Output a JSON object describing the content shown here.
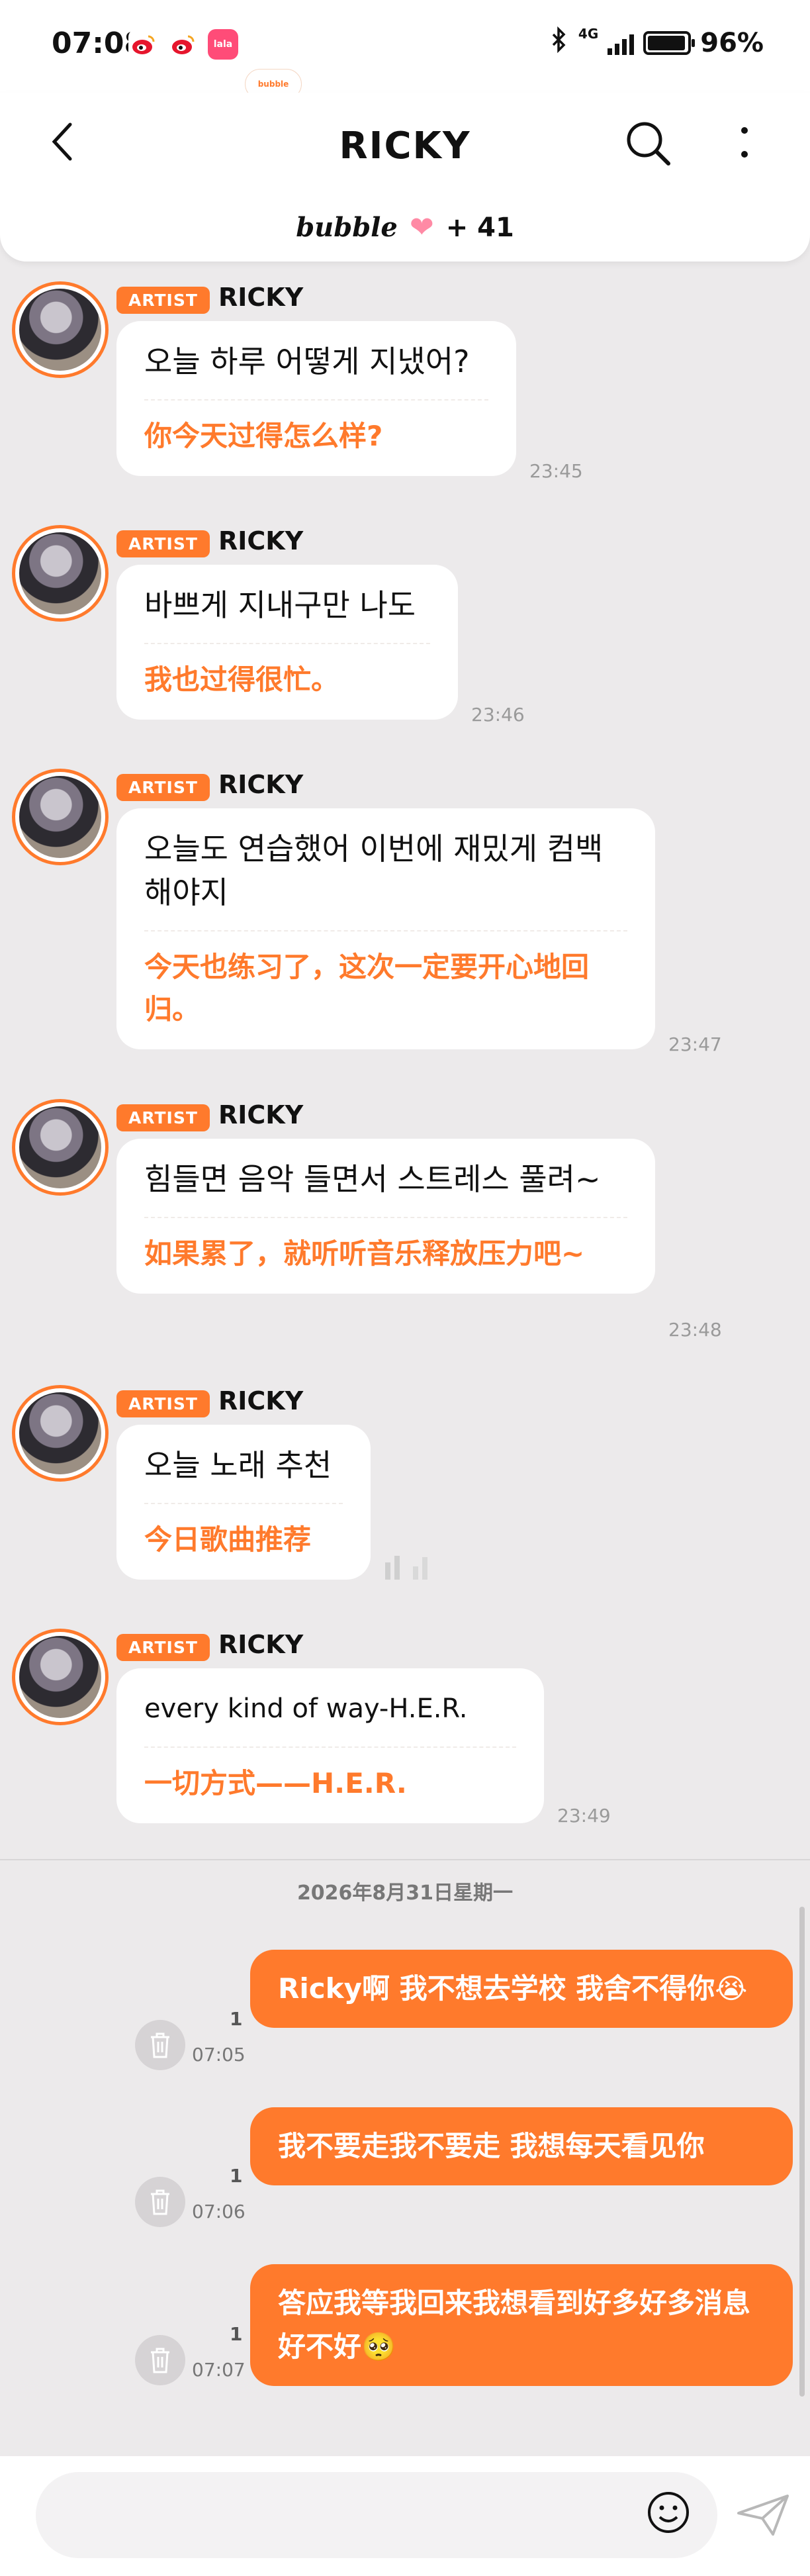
{
  "status_bar": {
    "time": "07:08",
    "apps": [
      "bubble",
      "weibo",
      "weibo",
      "lala"
    ],
    "network": "4G",
    "battery": "96%",
    "battery_level": 0.96
  },
  "header": {
    "title": "RICKY",
    "bubble_label": "bubble",
    "plus_count": "+ 41"
  },
  "colors": {
    "accent": "#ff7a2c",
    "background": "#eceaeb"
  },
  "artist_badge": "ARTIST",
  "messages": [
    {
      "sender": "RICKY",
      "korean": "오늘 하루 어떻게 지냈어?",
      "chinese": "你今天过得怎么样?",
      "time": "23:45"
    },
    {
      "sender": "RICKY",
      "korean": "바쁘게 지내구만 나도",
      "chinese": "我也过得很忙。",
      "time": "23:46"
    },
    {
      "sender": "RICKY",
      "korean": "오늘도 연습했어 이번에 재밌게 컴백 해야지",
      "chinese": "今天也练习了，这次一定要开心地回归。",
      "time": "23:47"
    },
    {
      "sender": "RICKY",
      "korean": "힘들면 음악 들면서 스트레스 풀려~",
      "chinese": "如果累了，就听听音乐释放压力吧~",
      "time": "23:48"
    },
    {
      "sender": "RICKY",
      "korean": "오늘 노래 추천",
      "chinese": "今日歌曲推荐",
      "time": ""
    },
    {
      "sender": "RICKY",
      "korean": "every kind of way-H.E.R.",
      "chinese": "一切方式——H.E.R.",
      "time": "23:49"
    }
  ],
  "date_separator": "2026年8月31日星期一",
  "my_messages": [
    {
      "text": "Ricky啊 我不想去学校 我舍不得你😭",
      "unread": "1",
      "time": "07:05"
    },
    {
      "text": "我不要走我不要走 我想每天看见你",
      "unread": "1",
      "time": "07:06"
    },
    {
      "text": "答应我等我回来我想看到好多好多消息好不好🥺",
      "unread": "1",
      "time": "07:07"
    }
  ]
}
